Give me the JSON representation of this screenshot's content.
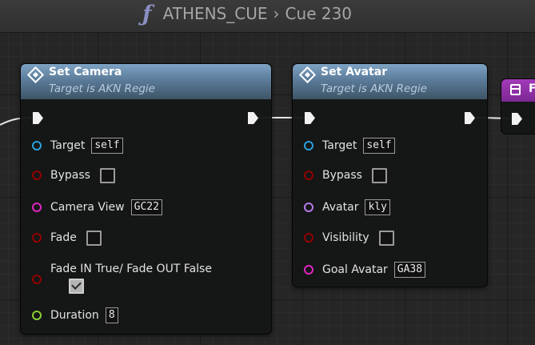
{
  "breadcrumb": {
    "function_icon": "ƒ",
    "parent": "ATHENS_CUE",
    "separator": "›",
    "current": "Cue 230"
  },
  "nodes": [
    {
      "title": "Set Camera",
      "subtitle": "Target is AKN Regie",
      "icon": "function-diamond-icon",
      "pins": [
        {
          "label": "Target",
          "type": "object",
          "value": "self"
        },
        {
          "label": "Bypass",
          "type": "bool",
          "checked": false
        },
        {
          "label": "Camera View",
          "type": "string",
          "value": "GC22"
        },
        {
          "label": "Fade",
          "type": "bool",
          "checked": false
        },
        {
          "label": "Fade IN True/ Fade OUT False",
          "type": "bool",
          "checked": true
        },
        {
          "label": "Duration",
          "type": "number",
          "value": "8"
        }
      ]
    },
    {
      "title": "Set Avatar",
      "subtitle": "Target is AKN Regie",
      "icon": "function-diamond-icon",
      "pins": [
        {
          "label": "Target",
          "type": "object",
          "value": "self"
        },
        {
          "label": "Bypass",
          "type": "bool",
          "checked": false
        },
        {
          "label": "Avatar",
          "type": "name",
          "value": "kly"
        },
        {
          "label": "Visibility",
          "type": "bool",
          "checked": false
        },
        {
          "label": "Goal Avatar",
          "type": "string",
          "value": "GA38"
        }
      ]
    },
    {
      "title": "F",
      "icon": "macro-icon"
    }
  ],
  "colors": {
    "node_header": "#5b7b99",
    "third_node_header": "#8e30a6",
    "pin_object": "#2aa0dc",
    "pin_bool": "#920000",
    "pin_string": "#e026c3",
    "pin_name": "#b57be6",
    "pin_number": "#8ecf38",
    "exec_pin": "#f1f1f1"
  }
}
